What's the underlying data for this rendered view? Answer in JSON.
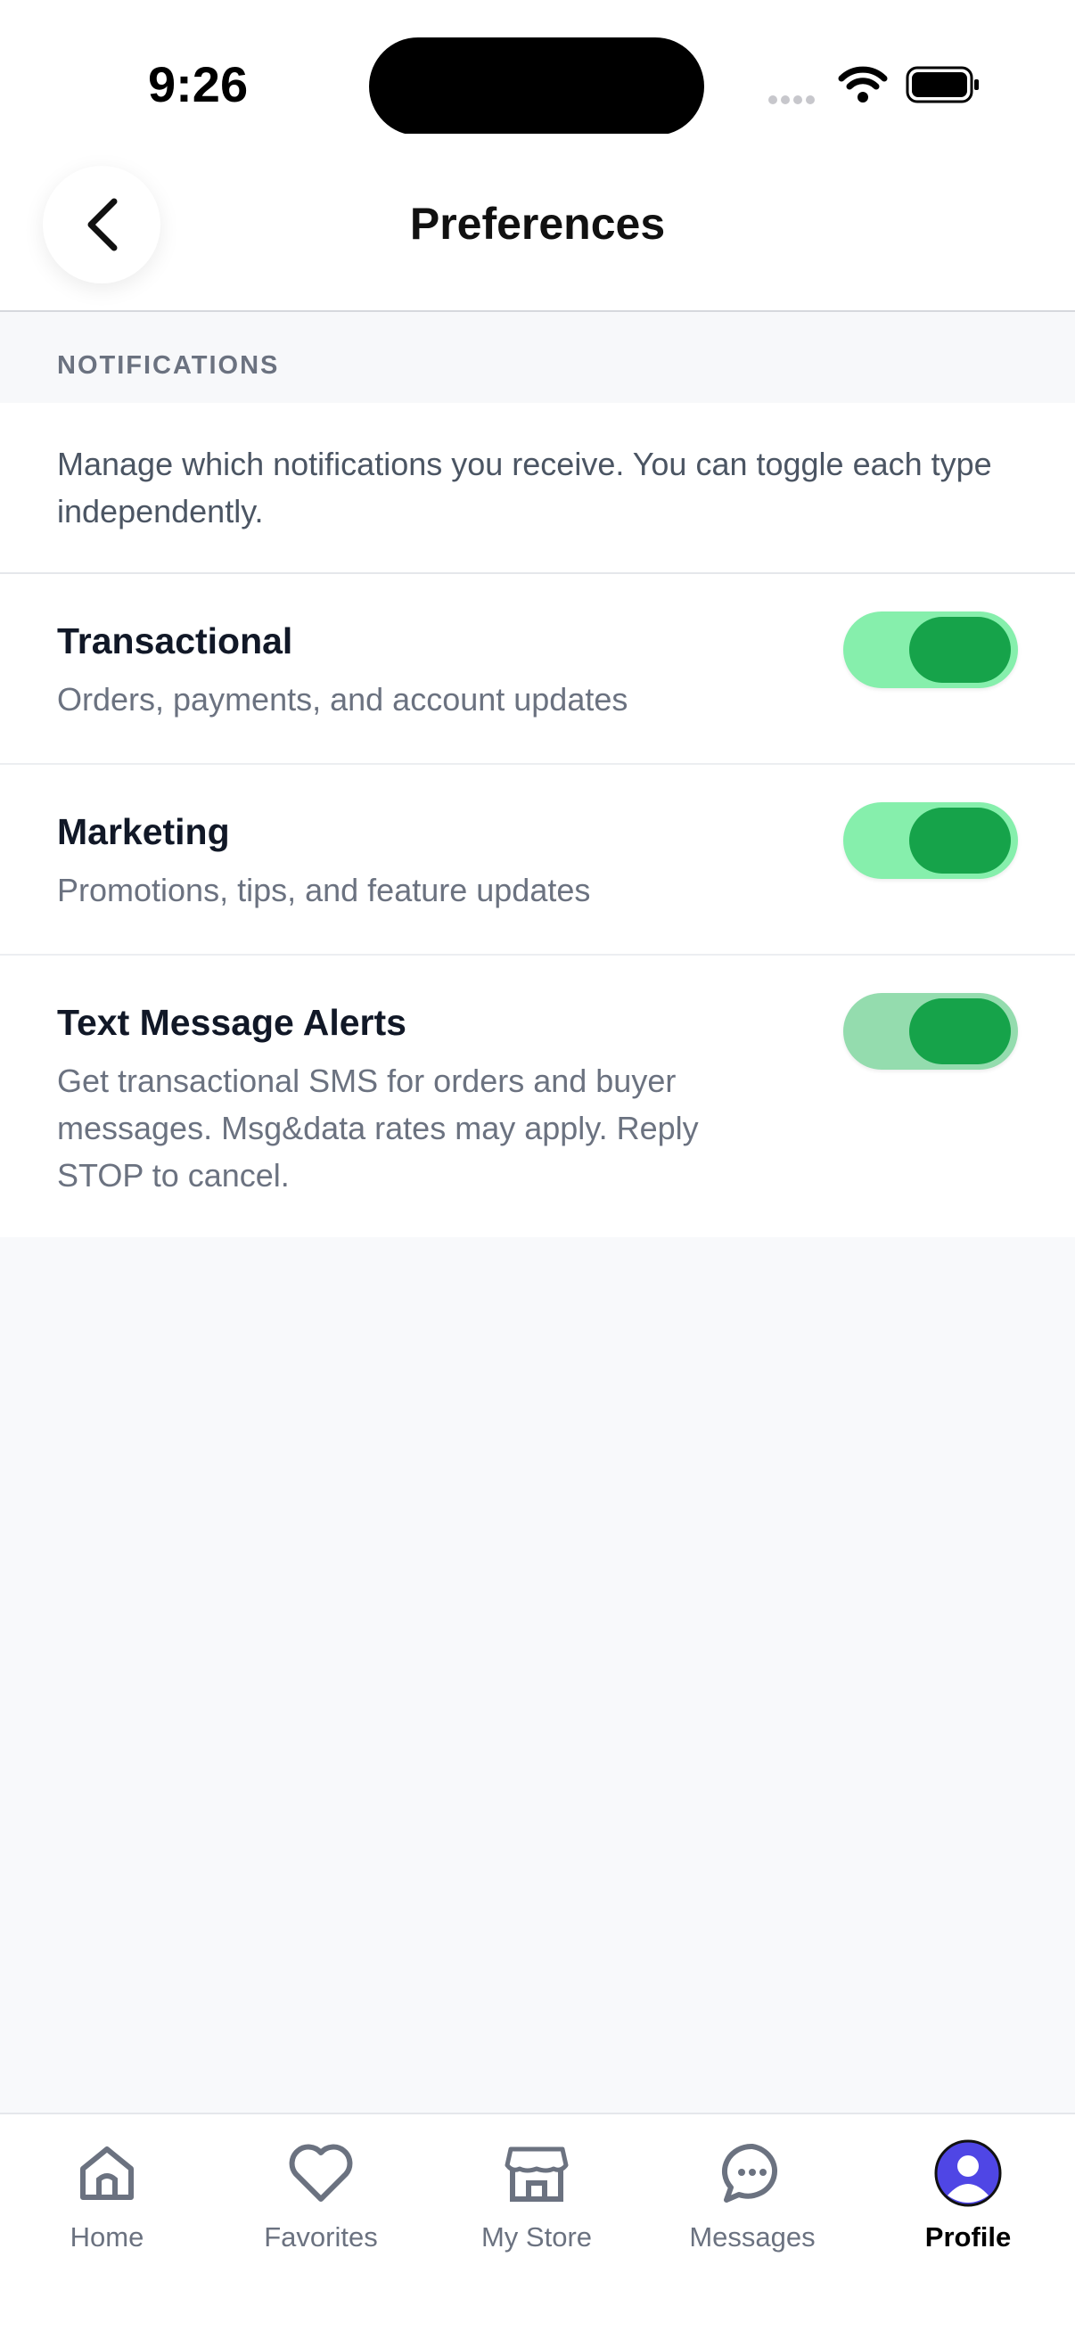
{
  "status": {
    "time": "9:26"
  },
  "header": {
    "title": "Preferences"
  },
  "section": {
    "title": "NOTIFICATIONS",
    "intro": "Manage which notifications you receive. You can toggle each type independently."
  },
  "settings": [
    {
      "label": "Transactional",
      "description": "Orders, payments, and account updates",
      "enabled": true
    },
    {
      "label": "Marketing",
      "description": "Promotions, tips, and feature updates",
      "enabled": true
    },
    {
      "label": "Text Message Alerts",
      "description": "Get transactional SMS for orders and buyer messages. Msg&data rates may apply. Reply STOP to cancel.",
      "enabled": true
    }
  ],
  "tabs": [
    {
      "label": "Home",
      "icon": "home-icon"
    },
    {
      "label": "Favorites",
      "icon": "heart-icon"
    },
    {
      "label": "My Store",
      "icon": "store-icon"
    },
    {
      "label": "Messages",
      "icon": "chat-icon"
    },
    {
      "label": "Profile",
      "icon": "avatar-icon",
      "active": true
    }
  ],
  "colors": {
    "accent": "#16a34a",
    "toggle_track": "#86efac",
    "profile": "#4f46e5"
  }
}
